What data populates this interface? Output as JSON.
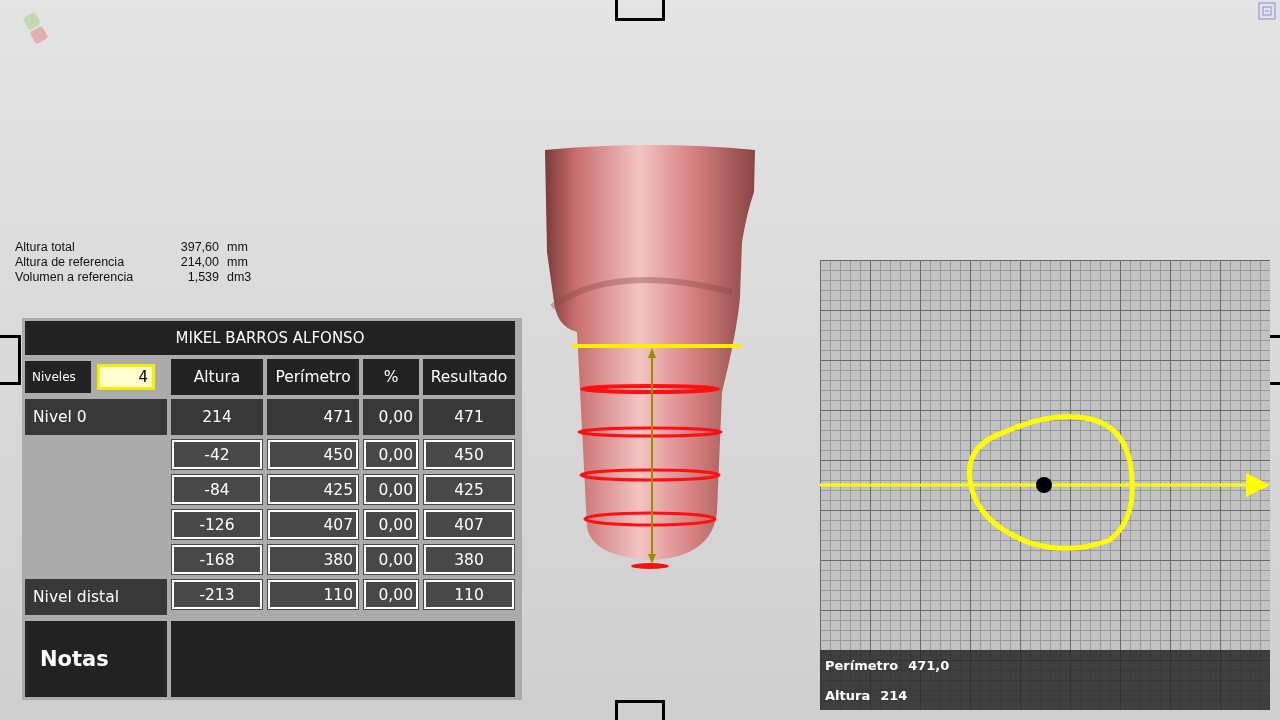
{
  "stats": [
    {
      "label": "Altura total",
      "value": "397,60",
      "unit": "mm"
    },
    {
      "label": "Altura de referencia",
      "value": "214,00",
      "unit": "mm"
    },
    {
      "label": "Volumen a referencia",
      "value": "1,539",
      "unit": "dm3"
    }
  ],
  "table": {
    "title": "MIKEL BARROS ALFONSO",
    "levels_label": "Niveles",
    "levels_value": "4",
    "columns": [
      "Altura",
      "Perímetro",
      "%",
      "Resultado"
    ],
    "rows": [
      {
        "kind": "reference",
        "label": "Nivel 0",
        "cells": [
          "214",
          "471",
          "0,00",
          "471"
        ]
      },
      {
        "kind": "level",
        "cells": [
          "-42",
          "450",
          "0,00",
          "450"
        ]
      },
      {
        "kind": "level",
        "cells": [
          "-84",
          "425",
          "0,00",
          "425"
        ]
      },
      {
        "kind": "level",
        "cells": [
          "-126",
          "407",
          "0,00",
          "407"
        ]
      },
      {
        "kind": "level",
        "cells": [
          "-168",
          "380",
          "0,00",
          "380"
        ]
      },
      {
        "kind": "level",
        "label": "Nivel distal",
        "cells": [
          "-213",
          "110",
          "0,00",
          "110"
        ]
      }
    ],
    "notes_label": "Notas"
  },
  "section_view": {
    "readings": [
      {
        "label": "Perímetro",
        "value": "471,0"
      },
      {
        "label": "Altura",
        "value": "214"
      }
    ]
  }
}
